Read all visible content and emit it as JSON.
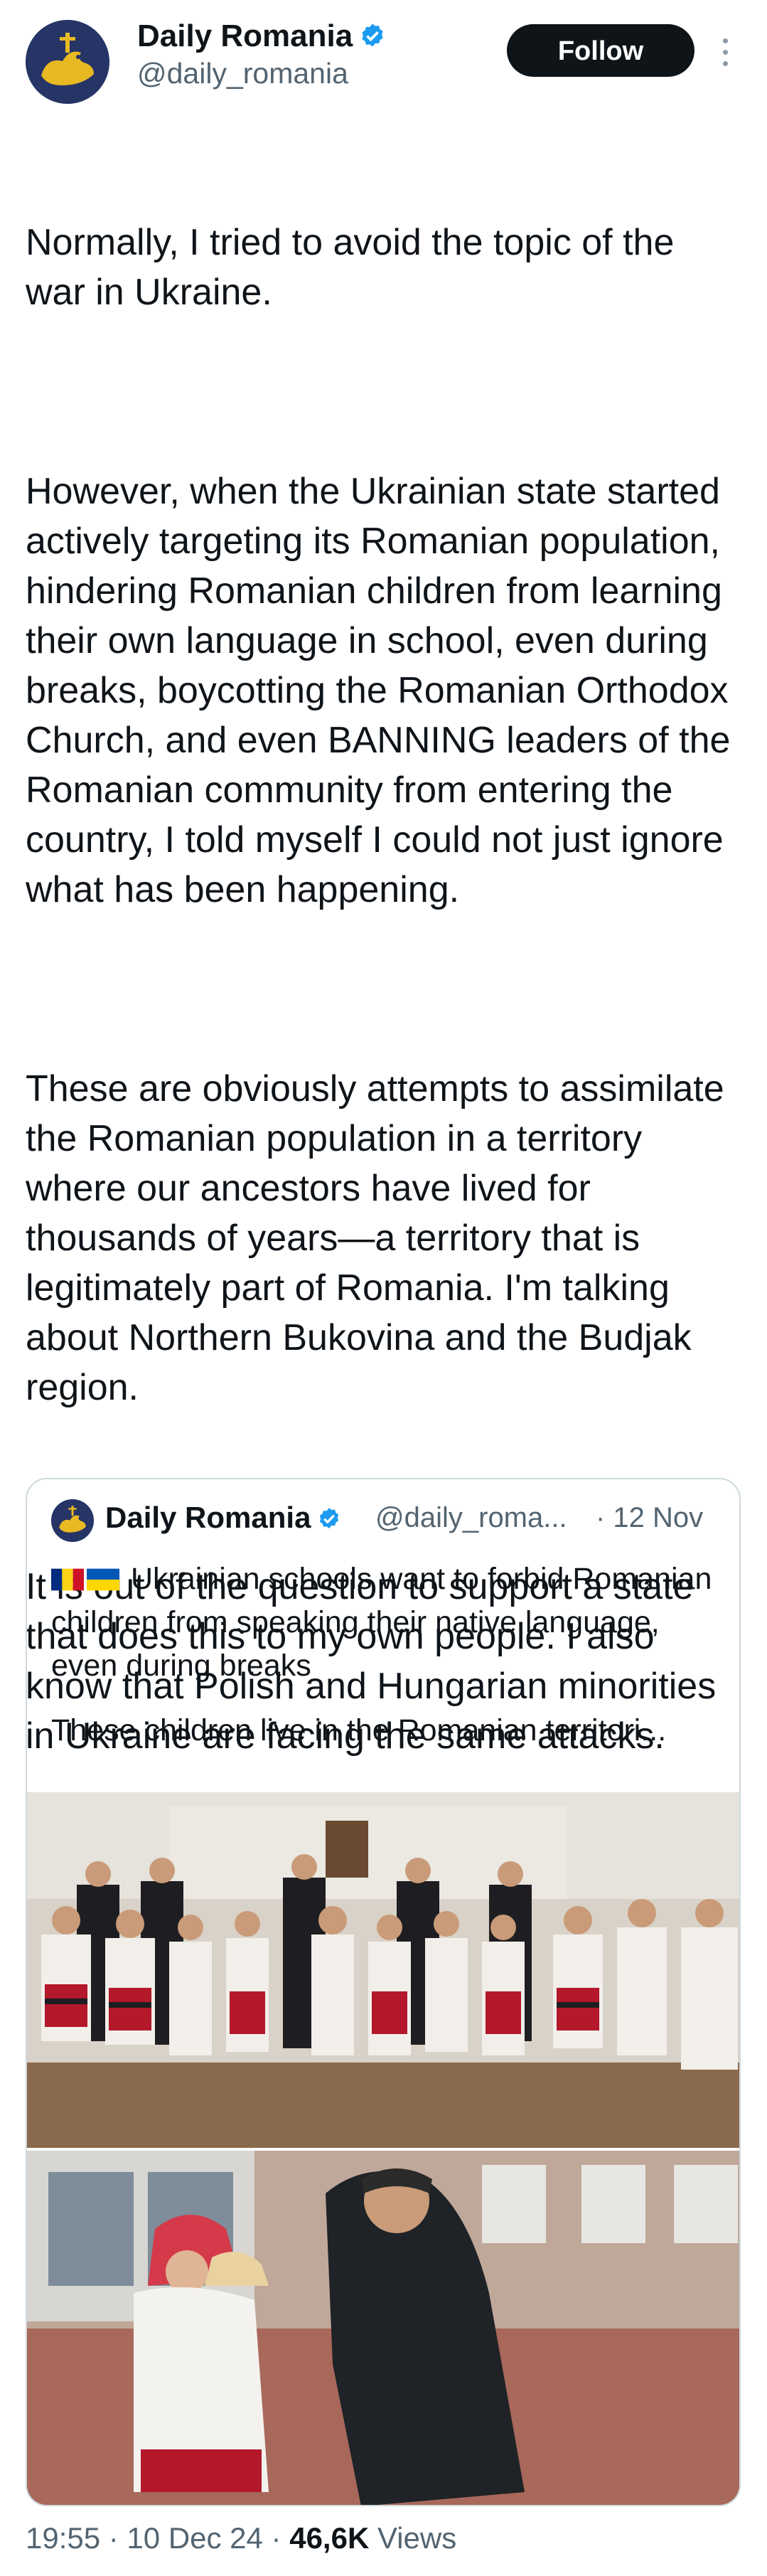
{
  "author": {
    "name": "Daily Romania",
    "handle": "@daily_romania",
    "follow_label": "Follow"
  },
  "tweet": {
    "paragraphs": [
      "Normally, I tried to avoid the topic of the war in Ukraine.",
      "However, when the Ukrainian state started actively targeting its Romanian population, hindering Romanian children from learning their own language in school, even during breaks, boycotting the Romanian Orthodox Church, and even BANNING leaders of the Romanian community from entering the country, I told myself I could not just ignore what has been happening.",
      "These are obviously attempts to assimilate the Romanian population in a territory where our ancestors have lived for thousands of years—a territory that is legitimately part of Romania. I'm talking about Northern Bukovina and the Budjak region.",
      "It is out of the question to support a state that does this to my own people. I also know that Polish and Hungarian minorities in Ukraine are facing the same attacks."
    ]
  },
  "quote": {
    "name": "Daily Romania",
    "handle": "@daily_roma...",
    "time": "· 12 Nov",
    "line1": "Ukrainian schools want to forbid Romanian children from speaking their native language, even during breaks",
    "line2": "These children live in the Romanian territori..."
  },
  "footer": {
    "time": "19:55 · 10 Dec 24 · ",
    "views_count": "46,6K",
    "views_label": " Views"
  },
  "colors": {
    "accent": "#1d9bf0",
    "text": "#0f1419",
    "muted": "#536471",
    "border": "#cfd9de"
  },
  "icons": [
    "verified-badge-icon",
    "more-options-icon",
    "romania-flag-icon",
    "ukraine-flag-icon"
  ]
}
